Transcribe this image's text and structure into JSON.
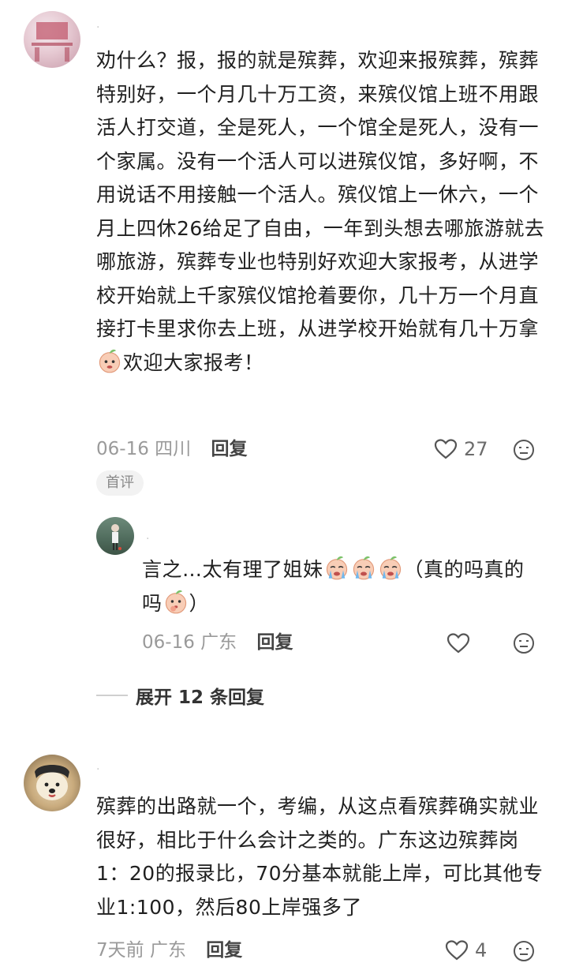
{
  "comment1": {
    "username": "·",
    "text": "劝什么？报，报的就是殡葬，欢迎来报殡葬，殡葬特别好，一个月几十万工资，来殡仪馆上班不用跟活人打交道，全是死人，一个馆全是死人，没有一个家属。没有一个活人可以进殡仪馆，多好啊，不用说话不用接触一个活人。殡仪馆上一休六，一个月上四休26给足了自由，一年到头想去哪旅游就去哪旅游，殡葬专业也特别好欢迎大家报考，从进学校开始就上千家殡仪馆抢着要你，几十万一个月直接打卡里求你去上班，从进学校开始就有几十万拿",
    "text_tail": "欢迎大家报考！",
    "date": "06-16",
    "location": "四川",
    "reply_label": "回复",
    "likes": "27",
    "badge": "首评"
  },
  "reply1": {
    "username": "·",
    "text_a": "言之…太有理了姐妹",
    "text_b": "（真的吗真的吗",
    "text_c": "）",
    "date": "06-16",
    "location": "广东",
    "reply_label": "回复"
  },
  "expand": {
    "label": "展开 12 条回复"
  },
  "comment2": {
    "username": "·",
    "text": "殡葬的出路就一个，考编，从这点看殡葬确实就业很好，相比于什么会计之类的。广东这边殡葬岗1：20的报录比，70分基本就能上岸，可比其他专业1:100，然后80上岸强多了",
    "date": "7天前",
    "location": "广东",
    "reply_label": "回复",
    "likes": "4"
  },
  "colors": {
    "text": "#202020",
    "meta": "#9a9a9a",
    "emoji_peach": "#f7c8b0"
  }
}
